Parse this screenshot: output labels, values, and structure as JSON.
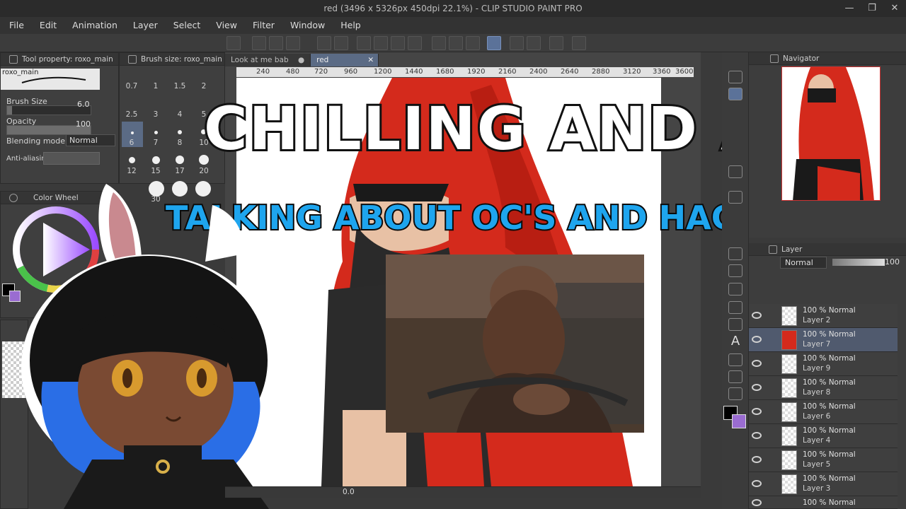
{
  "window": {
    "title": "red (3496 x 5326px 450dpi 22.1%)  - CLIP STUDIO PAINT PRO",
    "controls": [
      "—",
      "❐",
      "✕"
    ]
  },
  "menu": [
    "File",
    "Edit",
    "Animation",
    "Layer",
    "Select",
    "View",
    "Filter",
    "Window",
    "Help"
  ],
  "tool_property": {
    "title": "Tool property: roxo_main",
    "brush_name": "roxo_main",
    "brush_size_label": "Brush Size",
    "brush_size_value": "6.0",
    "opacity_label": "Opacity",
    "opacity_value": "100",
    "blending_label": "Blending mode",
    "blending_value": "Normal",
    "antialias_label": "Anti-aliasin"
  },
  "brush_size": {
    "title": "Brush size: roxo_main",
    "sizes": [
      "0.7",
      "1",
      "1.5",
      "2",
      "2.5",
      "3",
      "4",
      "5",
      "6",
      "7",
      "8",
      "10",
      "12",
      "15",
      "17",
      "20",
      "30"
    ]
  },
  "color_wheel": {
    "title": "Color Wheel"
  },
  "tabs": [
    "Look at me bab",
    "red"
  ],
  "ruler": [
    "240",
    "480",
    "720",
    "960",
    "1200",
    "1440",
    "1680",
    "1920",
    "2160",
    "2400",
    "2640",
    "2880",
    "3120",
    "3360",
    "3600"
  ],
  "overlay": {
    "headline": "CHILLING AND ARTING!",
    "subline": "TALKING ABOUT OC'S AND HAGINNIN OUT!"
  },
  "navigator": {
    "title": "Navigator"
  },
  "layer_panel": {
    "title": "Layer",
    "blend": "Normal",
    "opacity": "100",
    "layers": [
      {
        "mode": "100 % Normal",
        "name": "Layer 2"
      },
      {
        "mode": "100 % Normal",
        "name": "Layer 7"
      },
      {
        "mode": "100 % Normal",
        "name": "Layer 9"
      },
      {
        "mode": "100 % Normal",
        "name": "Layer 8"
      },
      {
        "mode": "100 % Normal",
        "name": "Layer 6"
      },
      {
        "mode": "100 % Normal",
        "name": "Layer 4"
      },
      {
        "mode": "100 % Normal",
        "name": "Layer 5"
      },
      {
        "mode": "100 % Normal",
        "name": "Layer 3"
      },
      {
        "mode": "100 % Normal",
        "name": ""
      }
    ]
  },
  "status": {
    "zoom": "0.0"
  },
  "colors": {
    "accent": "#5b7299",
    "red_hair": "#d42a1c",
    "headline_blue": "#1ea5ee"
  }
}
